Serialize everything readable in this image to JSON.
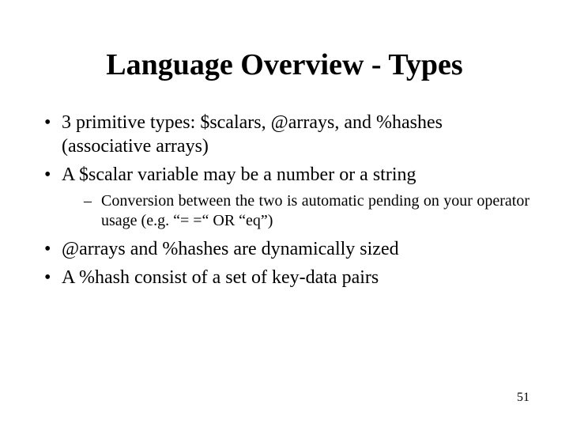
{
  "title": "Language Overview - Types",
  "bullets": {
    "b1": "3 primitive types: $scalars, @arrays, and %hashes (associative arrays)",
    "b2": "A $scalar variable may be a number or a string",
    "b2_sub1": "Conversion between the two is automatic pending on your operator usage (e.g. “= =“ OR “eq”)",
    "b3": "@arrays and %hashes are dynamically sized",
    "b4": "A %hash consist of a set of key-data pairs"
  },
  "page_number": "51"
}
